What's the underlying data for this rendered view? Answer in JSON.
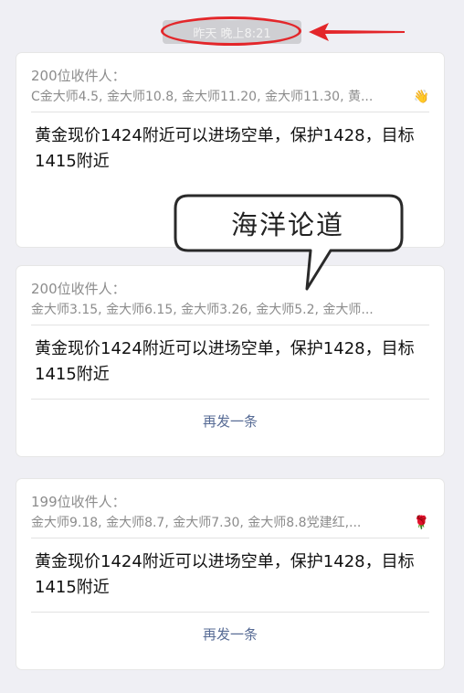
{
  "timestamp": "昨天 晚上8:21",
  "messages": [
    {
      "recipient_count": "200位收件人：",
      "recipients": "C金大师4.5, 金大师10.8, 金大师11.20, 金大师11.30, 黄...",
      "recipient_icon": "hand-emoji",
      "body": "黄金现价1424附近可以进场空单，保护1428，目标1415附近"
    },
    {
      "recipient_count": "200位收件人：",
      "recipients": "金大师3.15, 金大师6.15, 金大师3.26, 金大师5.2, 金大师...",
      "body": "黄金现价1424附近可以进场空单，保护1428，目标1415附近",
      "resend_label": "再发一条"
    },
    {
      "recipient_count": "199位收件人：",
      "recipients": "金大师9.18, 金大师8.7, 金大师7.30, 金大师8.8党建红,...",
      "recipient_icon": "rose-emoji",
      "body": "黄金现价1424附近可以进场空单，保护1428，目标1415附近",
      "resend_label": "再发一条"
    }
  ],
  "overlay": {
    "bubble_text": "海洋论道"
  },
  "colors": {
    "background": "#efeff4",
    "link": "#576b95",
    "annotation_red": "#e3262a",
    "muted_text": "#8c8c8c"
  }
}
